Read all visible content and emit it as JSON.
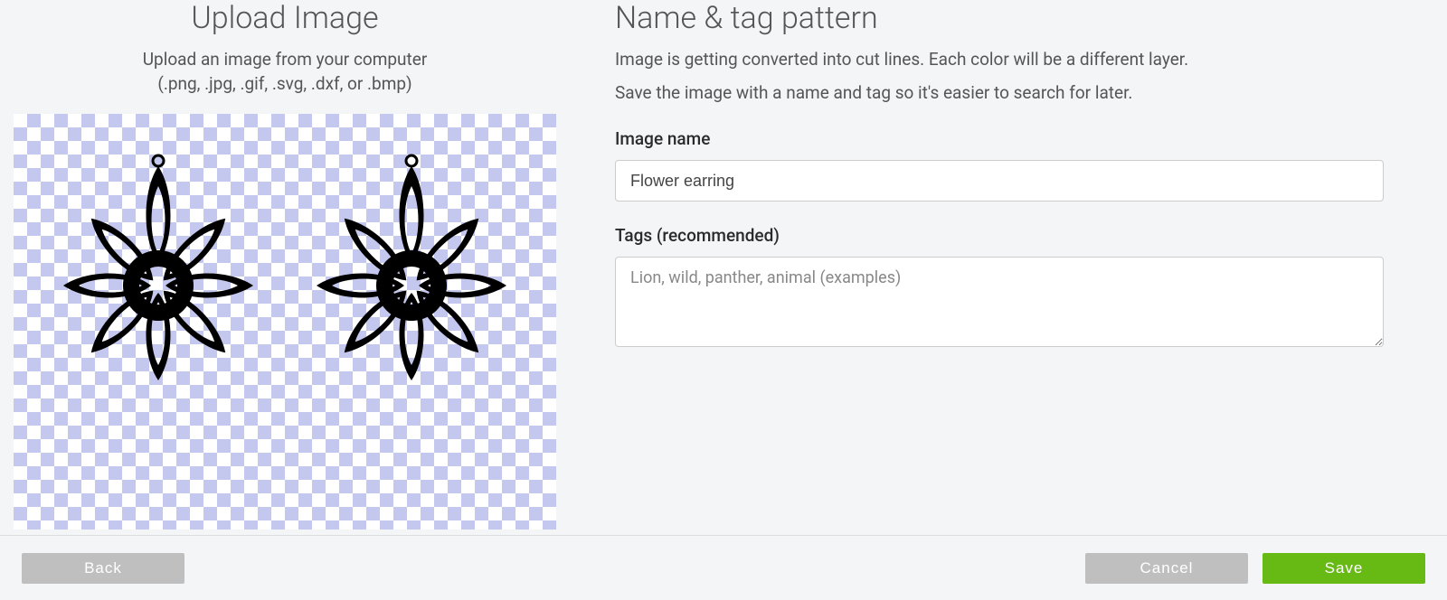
{
  "left": {
    "title": "Upload Image",
    "subtext1": "Upload an image from your computer",
    "subtext2": "(.png, .jpg, .gif, .svg, .dxf, or .bmp)"
  },
  "right": {
    "title": "Name & tag pattern",
    "para1": "Image is getting converted into cut lines. Each color will be a different layer.",
    "para2": "Save the image with a name and tag so it's easier to search for later.",
    "imageNameLabel": "Image name",
    "imageNameValue": "Flower earring",
    "tagsLabel": "Tags (recommended)",
    "tagsPlaceholder": "Lion, wild, panther, animal (examples)",
    "tagsValue": ""
  },
  "footer": {
    "back": "Back",
    "cancel": "Cancel",
    "save": "Save"
  }
}
